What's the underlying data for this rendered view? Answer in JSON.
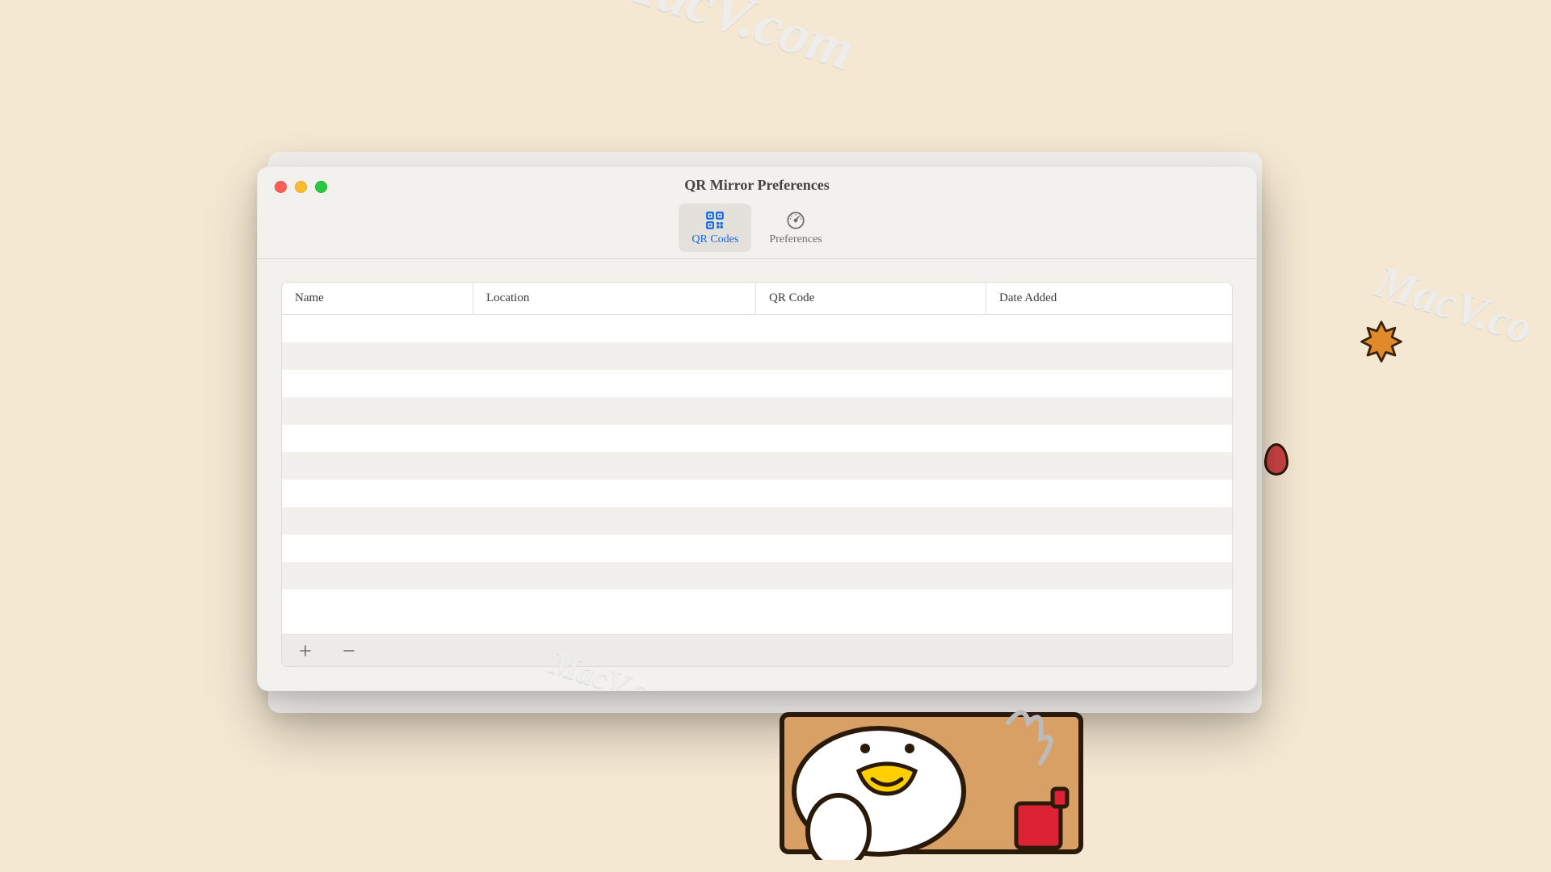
{
  "window": {
    "title": "QR Mirror Preferences"
  },
  "tabs": [
    {
      "label": "QR Codes",
      "active": true
    },
    {
      "label": "Preferences",
      "active": false
    }
  ],
  "table": {
    "columns": [
      "Name",
      "Location",
      "QR Code",
      "Date Added"
    ],
    "rows": []
  },
  "footer": {
    "add": "+",
    "remove": "–"
  },
  "watermarks": [
    "MacV.com",
    "MacV.co",
    "MacV.com"
  ]
}
